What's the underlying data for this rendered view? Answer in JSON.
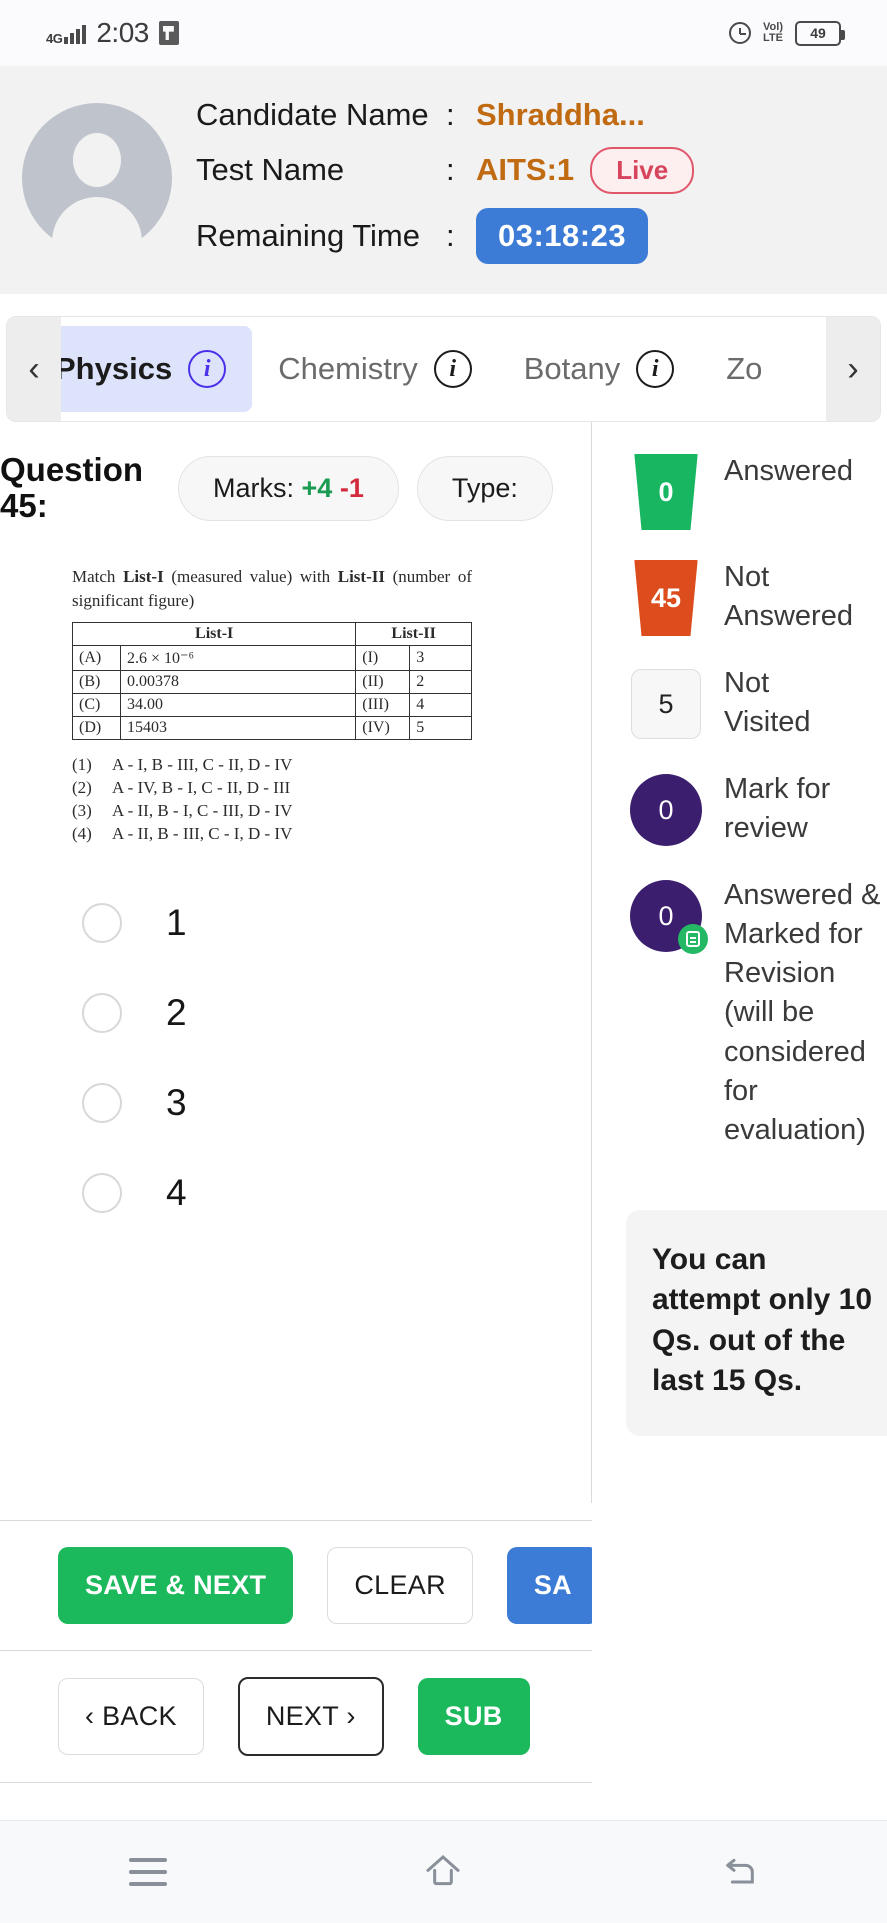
{
  "status_bar": {
    "network": "4G",
    "time": "2:03",
    "app_icon": "app-notification-icon",
    "alarm_icon": "alarm-icon",
    "volte": "VoLTE",
    "battery": "49"
  },
  "header": {
    "candidate_label": "Candidate Name",
    "candidate_value": "Shraddha...",
    "test_label": "Test Name",
    "test_value": "AITS:1",
    "live_badge": "Live",
    "time_label": "Remaining Time",
    "time_value": "03:18:23",
    "colon": ":"
  },
  "tabs": {
    "left_arrow": "‹",
    "right_arrow": "›",
    "items": [
      {
        "label": "Physics",
        "active": true
      },
      {
        "label": "Chemistry",
        "active": false
      },
      {
        "label": "Botany",
        "active": false
      },
      {
        "label": "Zo",
        "active": false
      }
    ]
  },
  "question": {
    "title": "Question 45:",
    "marks_label": "Marks:",
    "marks_positive": "+4",
    "marks_negative": "-1",
    "type_label": "Type:",
    "stem_part1": "Match ",
    "stem_b1": "List-I",
    "stem_part2": " (measured value) with ",
    "stem_b2": "List-II",
    "stem_part3": " (number of significant figure)",
    "table": {
      "head": [
        "List-I",
        "List-II"
      ],
      "rows": [
        {
          "k1": "(A)",
          "v1": "2.6 × 10⁻⁶",
          "k2": "(I)",
          "v2": "3"
        },
        {
          "k1": "(B)",
          "v1": "0.00378",
          "k2": "(II)",
          "v2": "2"
        },
        {
          "k1": "(C)",
          "v1": "34.00",
          "k2": "(III)",
          "v2": "4"
        },
        {
          "k1": "(D)",
          "v1": "15403",
          "k2": "(IV)",
          "v2": "5"
        }
      ]
    },
    "match_options": [
      {
        "n": "(1)",
        "t": "A - I, B - III, C - II, D - IV"
      },
      {
        "n": "(2)",
        "t": "A - IV, B - I, C - II, D - III"
      },
      {
        "n": "(3)",
        "t": "A - II, B - I, C - III, D - IV"
      },
      {
        "n": "(4)",
        "t": "A - II, B - III, C - I, D - IV"
      }
    ],
    "choices": [
      {
        "label": "1",
        "selected": false
      },
      {
        "label": "2",
        "selected": false
      },
      {
        "label": "3",
        "selected": false
      },
      {
        "label": "4",
        "selected": false
      }
    ]
  },
  "legend": [
    {
      "count": "0",
      "text": "Answered",
      "color": "#19b661",
      "shape": "trapezoid"
    },
    {
      "count": "45",
      "text": "Not\nAnswered",
      "color": "#dd4c1c",
      "shape": "trapezoid"
    },
    {
      "count": "5",
      "text": "Not\nVisited",
      "color": "#f7f7f7",
      "shape": "square"
    },
    {
      "count": "0",
      "text": "Mark for\nreview",
      "color": "#3b1f6e",
      "shape": "circle"
    },
    {
      "count": "0",
      "text": "Answered & Marked for Revision (will be considered for evaluation)",
      "color": "#3b1f6e",
      "shape": "circle-badge"
    }
  ],
  "note": "You can attempt only 10 Qs. out of the last 15 Qs.",
  "actions": {
    "save_next": "SAVE & NEXT",
    "clear": "CLEAR",
    "save_blue": "SA",
    "back": "‹ BACK",
    "next": "NEXT ›",
    "submit": "SUB"
  },
  "android_nav": {
    "recents": "menu-icon",
    "home": "home-icon",
    "back": "back-icon"
  }
}
